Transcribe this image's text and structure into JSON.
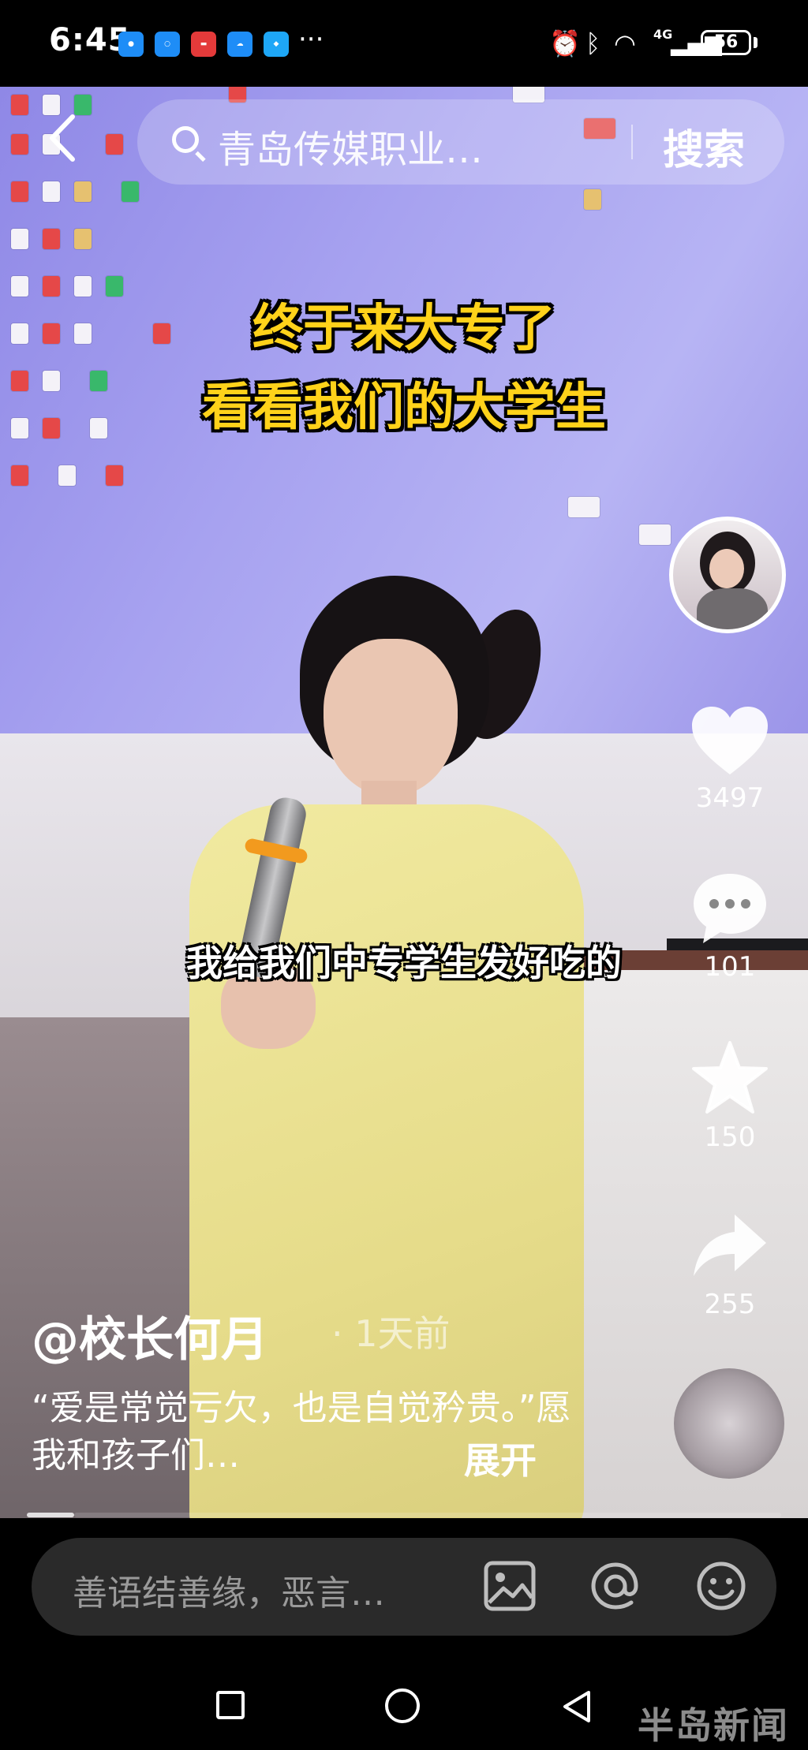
{
  "status_bar": {
    "time": "6:45",
    "network": "4G",
    "battery": "56",
    "more": "···"
  },
  "search": {
    "query": "青岛传媒职业…",
    "button": "搜索"
  },
  "video": {
    "caption_line1": "终于来大专了",
    "caption_line2": "看看我们的大学生",
    "subtitle": "我给我们中专学生发好吃的"
  },
  "actions": {
    "likes": "3497",
    "comments": "101",
    "favorites": "150",
    "shares": "255"
  },
  "post": {
    "author": "@校长何月",
    "time": "· 1天前",
    "description": "“爱是常觉亏欠，也是自觉矜贵。”愿我和孩子们…",
    "expand": "展开"
  },
  "comment": {
    "placeholder": "善语结善缘，恶言…"
  },
  "watermark": "半岛新闻",
  "colors": {
    "caption_yellow": "#ffd21a",
    "screen_purple": "#a7a2f0",
    "jacket_yellow": "#ede49a",
    "comment_bar": "#2a2a2a"
  }
}
